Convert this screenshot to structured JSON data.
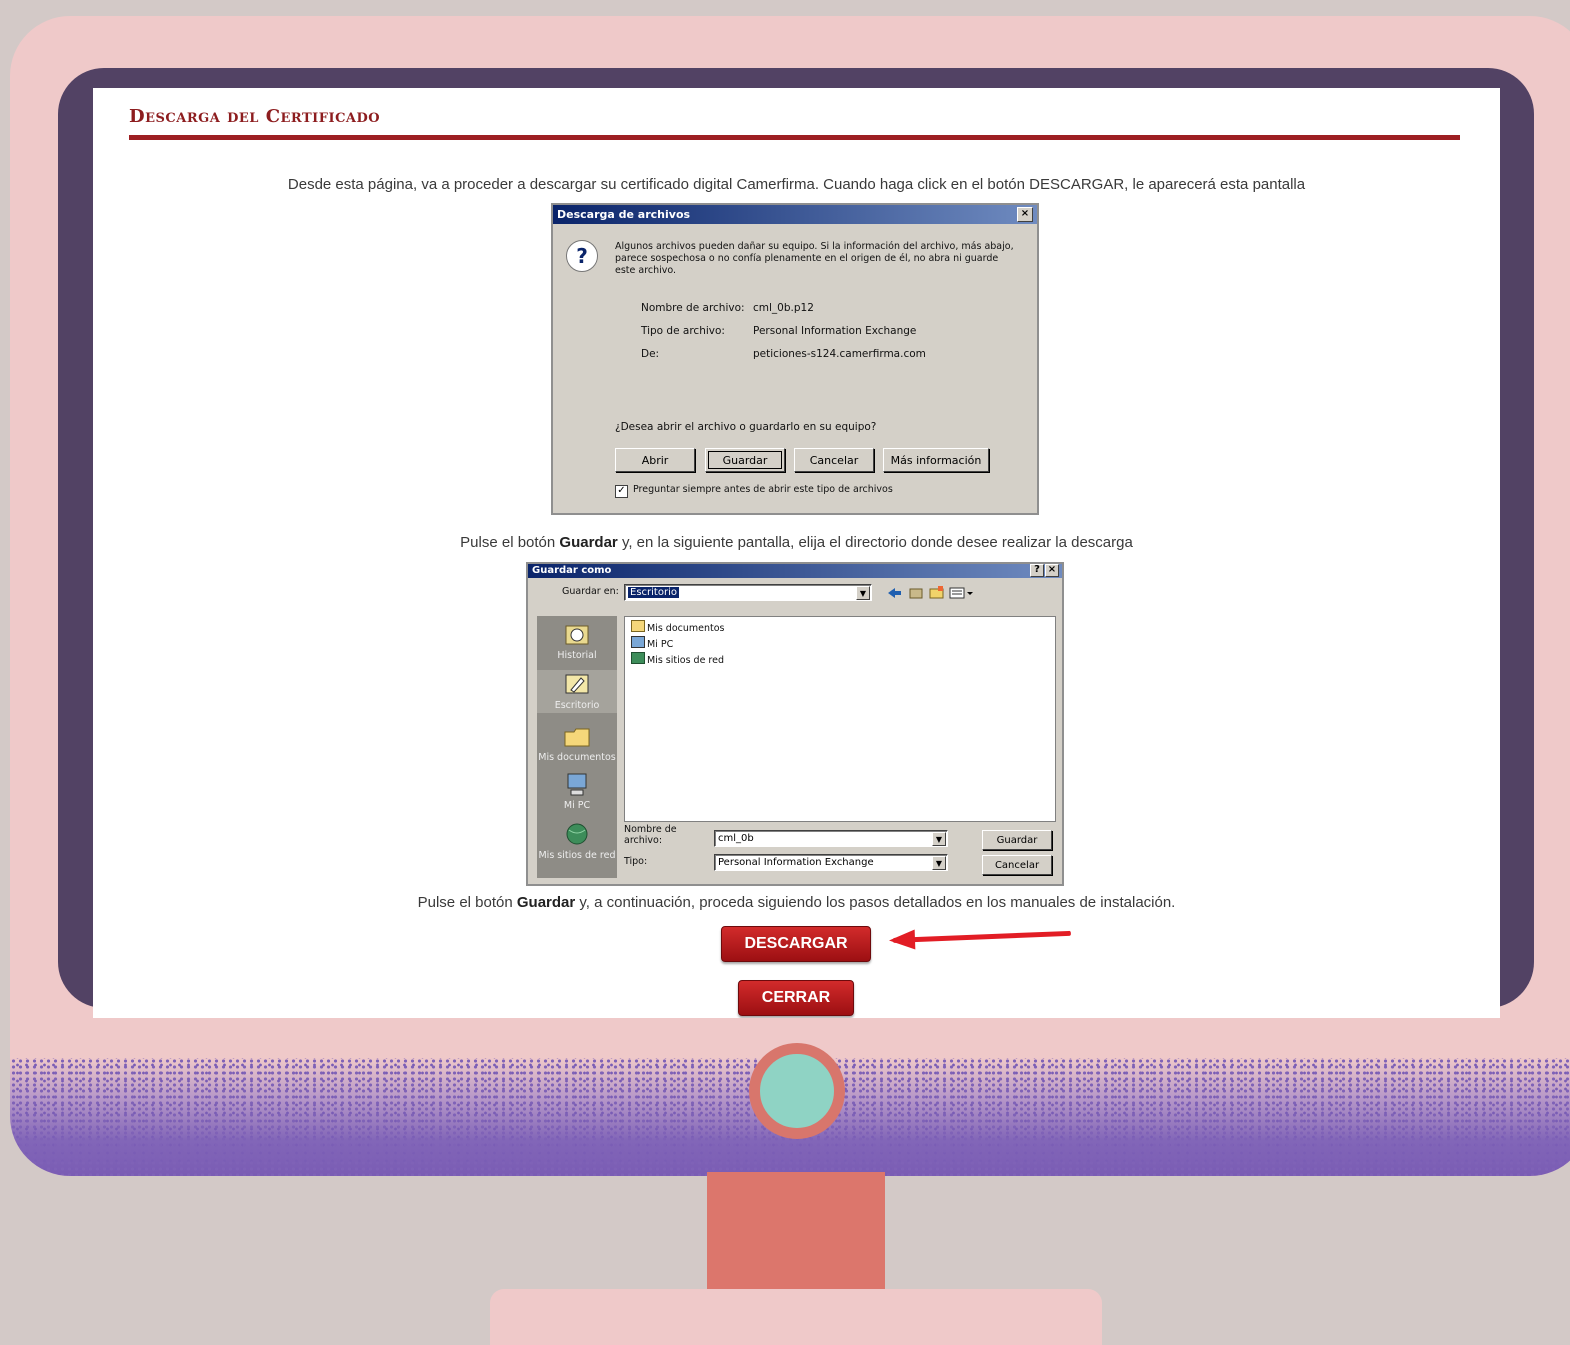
{
  "page": {
    "title": "Descarga del Certificado",
    "intro": "Desde esta página, va a proceder a descargar su certificado digital Camerfirma. Cuando haga click en el botón DESCARGAR, le aparecerá esta pantalla",
    "step2_pre": "Pulse el botón ",
    "step2_bold": "Guardar",
    "step2_post": " y, en la siguiente pantalla, elija el directorio donde desee realizar la descarga",
    "step3_pre": "Pulse el botón ",
    "step3_bold": "Guardar",
    "step3_post": " y, a continuación, proceda siguiendo los pasos detallados en los manuales de instalación.",
    "download_button": "DESCARGAR",
    "close_button": "CERRAR"
  },
  "download_dialog": {
    "title": "Descarga de archivos",
    "close_glyph": "×",
    "warning": "Algunos archivos pueden dañar su equipo. Si la información del archivo, más abajo, parece sospechosa o no confía plenamente en el origen de él, no abra ni guarde este archivo.",
    "filename_label": "Nombre de archivo:",
    "filename_value": "cml_0b.p12",
    "type_label": "Tipo de archivo:",
    "type_value": "Personal Information Exchange",
    "from_label": "De:",
    "from_value": "peticiones-s124.camerfirma.com",
    "question": "¿Desea abrir el archivo o guardarlo en su equipo?",
    "buttons": [
      "Abrir",
      "Guardar",
      "Cancelar",
      "Más información"
    ],
    "checkbox_label": "Preguntar siempre antes de abrir este tipo de archivos",
    "checkbox_checked": true
  },
  "save_dialog": {
    "title": "Guardar como",
    "help_glyph": "?",
    "close_glyph": "×",
    "save_in_label": "Guardar en:",
    "save_in_value": "Escritorio",
    "places": [
      "Historial",
      "Escritorio",
      "Mis documentos",
      "Mi PC",
      "Mis sitios de red"
    ],
    "files": [
      "Mis documentos",
      "Mi PC",
      "Mis sitios de red"
    ],
    "filename_label": "Nombre de archivo:",
    "filename_value": "cml_0b",
    "type_label": "Tipo:",
    "type_value": "Personal Information Exchange",
    "save_button": "Guardar",
    "cancel_button": "Cancelar"
  },
  "colors": {
    "title_red": "#8d1d1f",
    "button_red": "#b51a1d",
    "arrow_red": "#e21d25",
    "monitor_pink": "#efc9c9",
    "bezel": "#524264",
    "power_button": "#8fd3c4"
  }
}
